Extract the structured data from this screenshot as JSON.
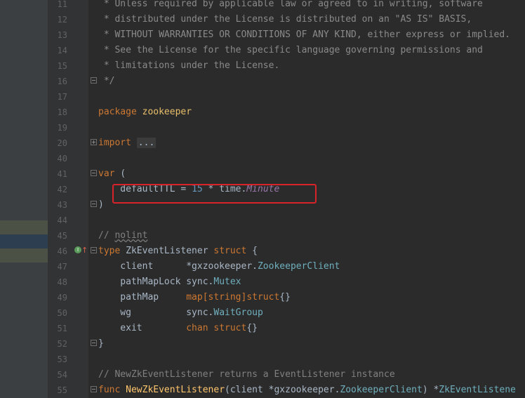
{
  "gutter": {
    "line_numbers": [
      "11",
      "12",
      "13",
      "14",
      "15",
      "16",
      "17",
      "18",
      "19",
      "20",
      "40",
      "41",
      "42",
      "43",
      "44",
      "45",
      "46",
      "47",
      "48",
      "49",
      "50",
      "51",
      "52",
      "53",
      "54",
      "55"
    ]
  },
  "code": {
    "l11": " * Unless required by applicable law or agreed to in writing, software",
    "l12": " * distributed under the License is distributed on an \"AS IS\" BASIS,",
    "l13": " * WITHOUT WARRANTIES OR CONDITIONS OF ANY KIND, either express or implied.",
    "l14": " * See the License for the specific language governing permissions and",
    "l15": " * limitations under the License.",
    "l16": " */",
    "l18_kw": "package",
    "l18_name": "zookeeper",
    "l20_kw": "import",
    "l20_fold": "...",
    "l41_kw": "var",
    "l41_p": " (",
    "l42_a": "    defaultTTL = ",
    "l42_num": "15",
    "l42_b": " * time.",
    "l42_field": "Minute",
    "l43": ")",
    "l45_cmt_a": "// ",
    "l45_cmt_b": "nolint",
    "l46_kw": "type",
    "l46_name": " ZkEventListener ",
    "l46_kw2": "struct",
    "l46_b": " {",
    "l47_a": "    client      *gxzookeeper.",
    "l47_type": "ZookeeperClient",
    "l48_a": "    pathMapLock sync.",
    "l48_type": "Mutex",
    "l49_a": "    pathMap     ",
    "l49_kw": "map[string]struct",
    "l49_b": "{}",
    "l50_a": "    wg          sync.",
    "l50_type": "WaitGroup",
    "l51_a": "    exit        ",
    "l51_kw": "chan struct",
    "l51_b": "{}",
    "l52": "}",
    "l54_a": "// NewZkEventListener ",
    "l54_b": "returns a EventListener instance",
    "l55_kw": "func",
    "l55_fn": " NewZkEventListener",
    "l55_a": "(client *gxzookeeper.",
    "l55_type": "ZookeeperClient",
    "l55_b": ") *",
    "l55_type2": "ZkEventListene"
  },
  "gutter_icons": {
    "implemented": "implemented-icon",
    "override": "up-arrow-icon"
  },
  "colors": {
    "highlight_box": "#d8232a",
    "keyword": "#cc7832",
    "number": "#6897bb",
    "type": "#6fafbd",
    "function": "#ffc66d"
  }
}
